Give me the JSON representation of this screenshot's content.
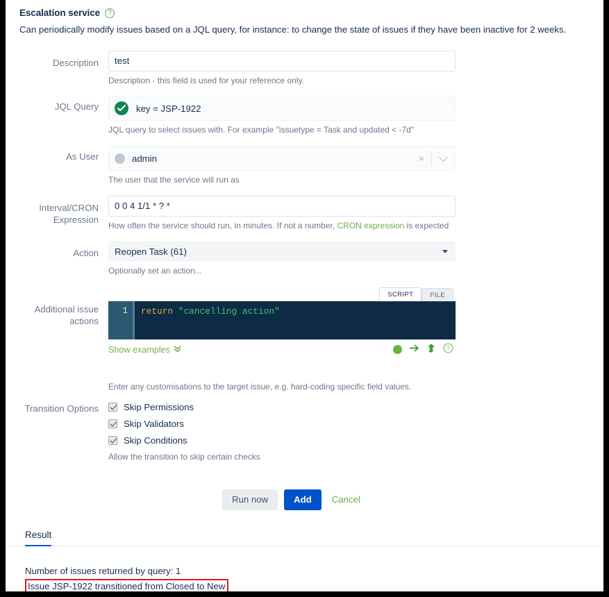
{
  "header": {
    "title": "Escalation service",
    "help_icon": "help-circle-icon",
    "description": "Can periodically modify issues based on a JQL query, for instance: to change the state of issues if they have been inactive for 2 weeks."
  },
  "form": {
    "description": {
      "label": "Description",
      "value": "test",
      "placeholder": "",
      "hint": "Description - this field is used for your reference only."
    },
    "jql_query": {
      "label": "JQL Query",
      "value": "key = JSP-1922",
      "status_icon": "valid-check-icon",
      "hint": "JQL query to select issues with. For example \"issuetype = Task and updated < -7d\""
    },
    "as_user": {
      "label": "As User",
      "value": "admin",
      "avatar_icon": "user-avatar-icon",
      "clear_icon": "×",
      "hint": "The user that the service will run as"
    },
    "interval": {
      "label": "Interval/CRON Expression",
      "value": "0 0 4 1/1 * ? *",
      "hint_before": "How often the service should run, in minutes. If not a number, ",
      "hint_link": "CRON expression",
      "hint_after": " is expected"
    },
    "action": {
      "label": "Action",
      "value": "Reopen Task (61)",
      "hint": "Optionally set an action..."
    },
    "additional_actions": {
      "label": "Additional issue actions",
      "tabs": [
        {
          "label": "SCRIPT",
          "active": true
        },
        {
          "label": "FILE",
          "active": false
        }
      ],
      "line_number": "1",
      "code_keyword": "return ",
      "code_string": "\"cancelling action\"",
      "show_examples": "Show examples",
      "show_examples_chevron": "»",
      "icons": [
        "status-green-dot-icon",
        "run-arrow-icon",
        "upload-arrow-icon",
        "help-circle-icon"
      ],
      "hint": "Enter any customisations to the target issue, e.g. hard-coding specific field values."
    },
    "transition_options": {
      "label": "Transition Options",
      "items": [
        {
          "label": "Skip Permissions",
          "checked": true
        },
        {
          "label": "Skip Validators",
          "checked": true
        },
        {
          "label": "Skip Conditions",
          "checked": true
        }
      ],
      "hint": "Allow the transition to skip certain checks"
    }
  },
  "buttons": {
    "run_now": "Run now",
    "add": "Add",
    "cancel": "Cancel"
  },
  "result": {
    "tab_label": "Result",
    "line1": "Number of issues returned by query: 1",
    "line2": "Issue JSP-1922 transitioned from Closed to New"
  },
  "colors": {
    "primary": "#0052cc",
    "link_green": "#6aab4a",
    "valid_green": "#0f8553",
    "highlight_red": "#e01b1b",
    "editor_bg": "#0d2b45"
  }
}
